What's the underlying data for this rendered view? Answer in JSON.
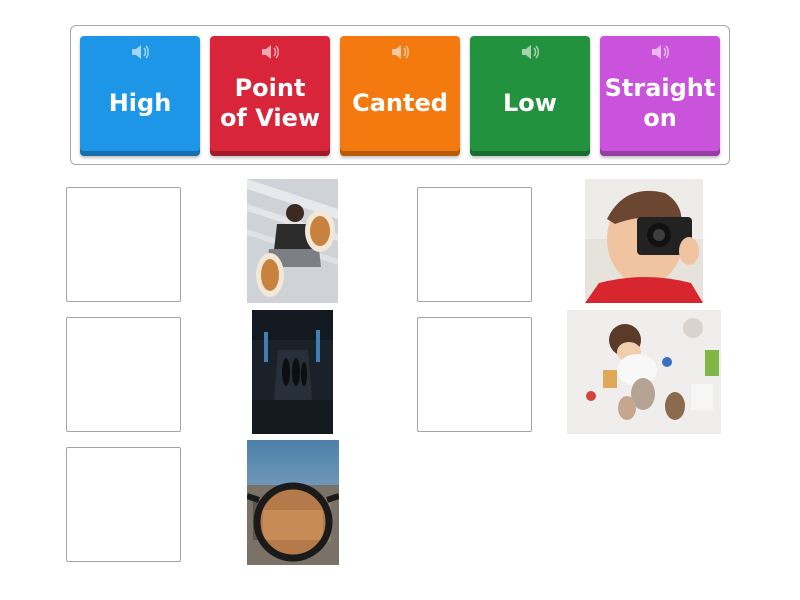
{
  "tiles": [
    {
      "label": "High",
      "color": "#1e96e8",
      "icon": "speaker-icon"
    },
    {
      "label": "Point\nof View",
      "color": "#d9253a",
      "icon": "speaker-icon"
    },
    {
      "label": "Canted",
      "color": "#f47a0f",
      "icon": "speaker-icon"
    },
    {
      "label": "Low",
      "color": "#22923e",
      "icon": "speaker-icon"
    },
    {
      "label": "Straight\non",
      "color": "#c953db",
      "icon": "speaker-icon"
    }
  ],
  "photos": [
    {
      "subject": "low-angle person in sneakers"
    },
    {
      "subject": "child holding camera"
    },
    {
      "subject": "dark corridor figures"
    },
    {
      "subject": "baby with toys from above"
    },
    {
      "subject": "city through glasses"
    }
  ]
}
